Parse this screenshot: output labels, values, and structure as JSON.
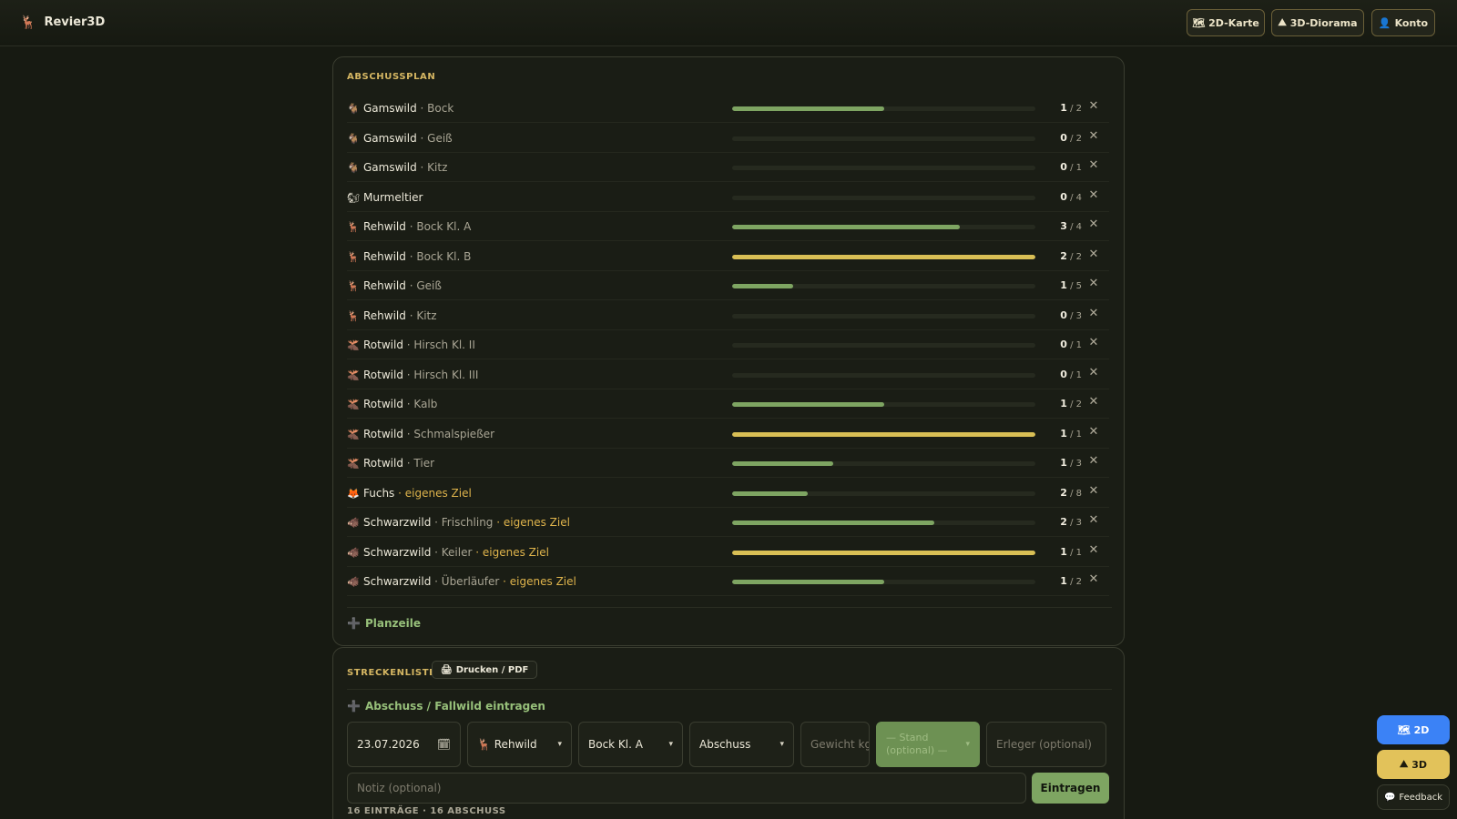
{
  "header": {
    "brand_icon": "🦌",
    "brand_name": "Revier3D",
    "buttons": [
      {
        "icon": "🗺",
        "label": "2D-Karte"
      },
      {
        "icon": "⛰",
        "label": "3D-Diorama"
      },
      {
        "icon": "👤",
        "label": "Konto"
      }
    ]
  },
  "plan": {
    "title": "ABSCHUSSPLAN",
    "add_label": "Planzeile",
    "add_icon": "➕",
    "colors": {
      "in_progress": "#7ea562",
      "complete": "#d9bf55"
    },
    "rows": [
      {
        "icon": "🐐",
        "species": "Gamswild",
        "sub": "Bock",
        "goal": "",
        "done": "1",
        "total": "2",
        "progress": 0.5
      },
      {
        "icon": "🐐",
        "species": "Gamswild",
        "sub": "Geiß",
        "goal": "",
        "done": "0",
        "total": "2",
        "progress": 0
      },
      {
        "icon": "🐐",
        "species": "Gamswild",
        "sub": "Kitz",
        "goal": "",
        "done": "0",
        "total": "1",
        "progress": 0
      },
      {
        "icon": "🐿",
        "species": "Murmeltier",
        "sub": "",
        "goal": "",
        "done": "0",
        "total": "4",
        "progress": 0
      },
      {
        "icon": "🦌",
        "species": "Rehwild",
        "sub": "Bock Kl. A",
        "goal": "",
        "done": "3",
        "total": "4",
        "progress": 0.75
      },
      {
        "icon": "🦌",
        "species": "Rehwild",
        "sub": "Bock Kl. B",
        "goal": "",
        "done": "2",
        "total": "2",
        "progress": 1
      },
      {
        "icon": "🦌",
        "species": "Rehwild",
        "sub": "Geiß",
        "goal": "",
        "done": "1",
        "total": "5",
        "progress": 0.2
      },
      {
        "icon": "🦌",
        "species": "Rehwild",
        "sub": "Kitz",
        "goal": "",
        "done": "0",
        "total": "3",
        "progress": 0
      },
      {
        "icon": "🫎",
        "species": "Rotwild",
        "sub": "Hirsch Kl. II",
        "goal": "",
        "done": "0",
        "total": "1",
        "progress": 0
      },
      {
        "icon": "🫎",
        "species": "Rotwild",
        "sub": "Hirsch Kl. III",
        "goal": "",
        "done": "0",
        "total": "1",
        "progress": 0
      },
      {
        "icon": "🫎",
        "species": "Rotwild",
        "sub": "Kalb",
        "goal": "",
        "done": "1",
        "total": "2",
        "progress": 0.5
      },
      {
        "icon": "🫎",
        "species": "Rotwild",
        "sub": "Schmalspießer",
        "goal": "",
        "done": "1",
        "total": "1",
        "progress": 1
      },
      {
        "icon": "🫎",
        "species": "Rotwild",
        "sub": "Tier",
        "goal": "",
        "done": "1",
        "total": "3",
        "progress": 0.333
      },
      {
        "icon": "🦊",
        "species": "Fuchs",
        "sub": "",
        "goal": "eigenes Ziel",
        "done": "2",
        "total": "8",
        "progress": 0.25
      },
      {
        "icon": "🐗",
        "species": "Schwarzwild",
        "sub": "Frischling",
        "goal": "eigenes Ziel",
        "done": "2",
        "total": "3",
        "progress": 0.667
      },
      {
        "icon": "🐗",
        "species": "Schwarzwild",
        "sub": "Keiler",
        "goal": "eigenes Ziel",
        "done": "1",
        "total": "1",
        "progress": 1
      },
      {
        "icon": "🐗",
        "species": "Schwarzwild",
        "sub": "Überläufer",
        "goal": "eigenes Ziel",
        "done": "1",
        "total": "2",
        "progress": 0.5
      }
    ]
  },
  "strecke": {
    "title": "STRECKENLISTE",
    "print_icon": "🖨",
    "print_label": "Drucken / PDF",
    "add_icon": "➕",
    "add_label": "Abschuss / Fallwild eintragen",
    "date_value": "23.07.2026",
    "species_value": "🦌 Rehwild",
    "class_value": "Bock Kl. A",
    "type_value": "Abschuss",
    "weight_placeholder": "Gewicht kg",
    "stand_placeholder": "— Stand (optional) —",
    "hunter_placeholder": "Erleger (optional)",
    "note_placeholder": "Notiz (optional)",
    "submit_label": "Eintragen",
    "summary": "16 EINTRÄGE · 16 ABSCHUSS"
  },
  "floating": {
    "btn_2d_icon": "🗺",
    "btn_2d_label": "2D",
    "btn_3d_icon": "⛰",
    "btn_3d_label": "3D",
    "feedback_icon": "💬",
    "feedback_label": "Feedback"
  }
}
